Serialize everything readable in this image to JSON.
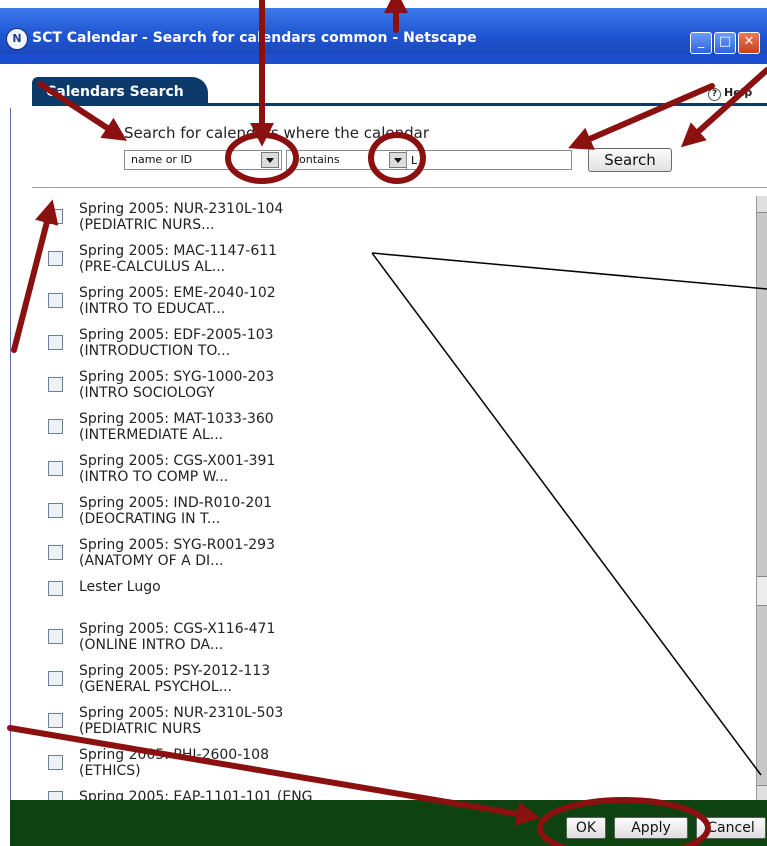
{
  "window": {
    "title": "SCT Calendar - Search for calendars common - Netscape",
    "app_icon_glyph": "N",
    "controls": {
      "minimize": "_",
      "maximize": "□",
      "close": "✕"
    }
  },
  "tab": {
    "label": "Calendars Search"
  },
  "help": {
    "label": "Help",
    "icon_glyph": "?"
  },
  "search": {
    "prompt": "Search for calenders where the calendar",
    "field_select": "name or ID",
    "operator_select": "contains",
    "input_value": "L",
    "button_label": "Search"
  },
  "results": [
    {
      "line1": "Spring 2005: NUR-2310L-104",
      "line2": "(PEDIATRIC NURS..."
    },
    {
      "line1": "Spring 2005: MAC-1147-611",
      "line2": "(PRE-CALCULUS AL..."
    },
    {
      "line1": "Spring 2005: EME-2040-102",
      "line2": "(INTRO TO EDUCAT..."
    },
    {
      "line1": "Spring 2005: EDF-2005-103",
      "line2": "(INTRODUCTION TO..."
    },
    {
      "line1": "Spring 2005: SYG-1000-203",
      "line2": "(INTRO SOCIOLOGY"
    },
    {
      "line1": "Spring 2005: MAT-1033-360",
      "line2": "(INTERMEDIATE AL..."
    },
    {
      "line1": "Spring 2005: CGS-X001-391",
      "line2": "(INTRO TO COMP W..."
    },
    {
      "line1": "Spring 2005: IND-R010-201",
      "line2": "(DEOCRATING IN T..."
    },
    {
      "line1": "Spring 2005: SYG-R001-293",
      "line2": "(ANATOMY OF A DI..."
    },
    {
      "line1": "Lester Lugo",
      "line2": ""
    },
    {
      "line1": "Spring 2005: CGS-X116-471",
      "line2": "(ONLINE INTRO DA..."
    },
    {
      "line1": "Spring 2005: PSY-2012-113",
      "line2": "(GENERAL PSYCHOL..."
    },
    {
      "line1": "Spring 2005: NUR-2310L-503",
      "line2": "(PEDIATRIC NURS"
    },
    {
      "line1": "Spring 2005: PHI-2600-108",
      "line2": "(ETHICS)"
    },
    {
      "line1": "Spring 2005: EAP-1101-101 (ENG",
      "line2": ""
    }
  ],
  "footer": {
    "ok_label": "OK",
    "apply_label": "Apply",
    "cancel_label": "Cancel"
  },
  "colors": {
    "titlebar": "#1f55d3",
    "tab": "#0c3a6b",
    "footer": "#0f4211",
    "annotation": "#8b1010"
  },
  "icons": [
    "netscape-icon",
    "minimize-icon",
    "maximize-icon",
    "close-icon",
    "help-icon",
    "dropdown-arrow-icon",
    "scroll-up-icon",
    "scroll-down-icon"
  ]
}
